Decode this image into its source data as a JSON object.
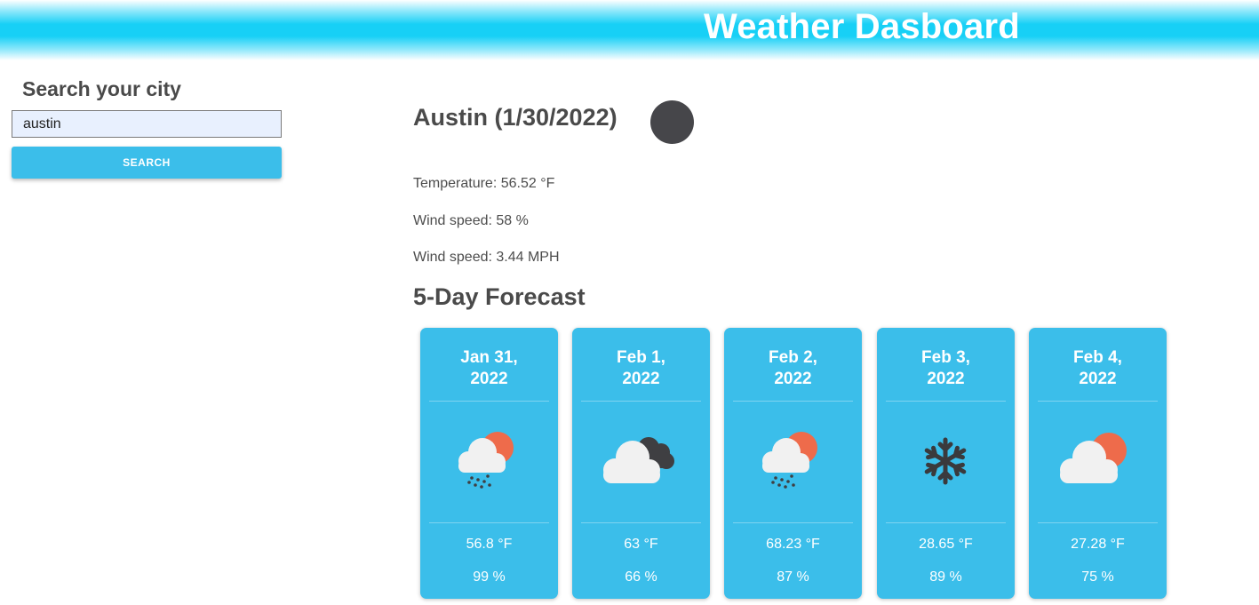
{
  "header": {
    "title": "Weather Dasboard"
  },
  "search": {
    "heading": "Search your city",
    "input_value": "austin",
    "button_label": "SEARCH"
  },
  "current": {
    "title": "Austin (1/30/2022)",
    "icon": "weather-icon",
    "temperature": "Temperature: 56.52 °F",
    "humidity": "Wind speed: 58 %",
    "wind": "Wind speed: 3.44 MPH"
  },
  "forecast": {
    "heading": "5-Day Forecast",
    "days": [
      {
        "date_line1": "Jan 31,",
        "date_line2": "2022",
        "icon": "rain-sun-cloud-icon",
        "temp": "56.8 °F",
        "humidity": "99 %"
      },
      {
        "date_line1": "Feb 1,",
        "date_line2": "2022",
        "icon": "overcast-cloud-icon",
        "temp": "63 °F",
        "humidity": "66 %"
      },
      {
        "date_line1": "Feb 2,",
        "date_line2": "2022",
        "icon": "rain-sun-cloud-icon",
        "temp": "68.23 °F",
        "humidity": "87 %"
      },
      {
        "date_line1": "Feb 3,",
        "date_line2": "2022",
        "icon": "snowflake-icon",
        "temp": "28.65 °F",
        "humidity": "89 %"
      },
      {
        "date_line1": "Feb 4,",
        "date_line2": "2022",
        "icon": "partly-cloudy-icon",
        "temp": "27.28 °F",
        "humidity": "75 %"
      }
    ]
  },
  "colors": {
    "header": "#17d0f6",
    "card": "#3bbeea",
    "button": "#3bbeea",
    "sun": "#ee6b4b",
    "cloud": "#f1f1f1",
    "dark_cloud": "#3f3f42"
  }
}
